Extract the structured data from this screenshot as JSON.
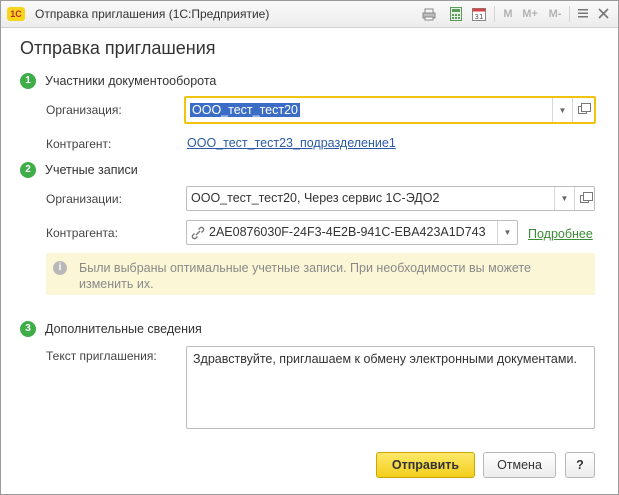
{
  "window": {
    "app_logo": "1С",
    "title": "Отправка приглашения  (1С:Предприятие)",
    "toolbar": {
      "m": "M",
      "m_plus": "M+",
      "m_minus": "M-"
    }
  },
  "form": {
    "title": "Отправка приглашения",
    "sections": [
      {
        "number": "1",
        "title": "Участники документооборота"
      },
      {
        "number": "2",
        "title": "Учетные записи"
      },
      {
        "number": "3",
        "title": "Дополнительные сведения"
      }
    ],
    "participants": {
      "org_label": "Организация:",
      "org_value": "ООО_тест_тест20",
      "counterparty_label": "Контрагент:",
      "counterparty_value": "ООО_тест_тест23_подразделение1"
    },
    "accounts": {
      "orgs_label": "Организации:",
      "orgs_value": "ООО_тест_тест20, Через сервис 1С-ЭДО2",
      "counterparties_label": "Контрагента:",
      "counterparties_value": "2AE0876030F-24F3-4E2B-941C-EBA423A1D743",
      "details_link": "Подробнее",
      "hint": "Были выбраны оптимальные учетные записи. При необходимости вы можете изменить их."
    },
    "additional": {
      "invite_label": "Текст приглашения:",
      "invite_text": "Здравствуйте, приглашаем к обмену электронными документами."
    },
    "buttons": {
      "send": "Отправить",
      "cancel": "Отмена",
      "help": "?"
    }
  },
  "colors": {
    "accent_yellow": "#f2ce1b",
    "section_green": "#3fae49",
    "link_blue": "#2a5aa6",
    "link_green": "#3a8b3a",
    "hint_bg": "#fbf6d5"
  }
}
